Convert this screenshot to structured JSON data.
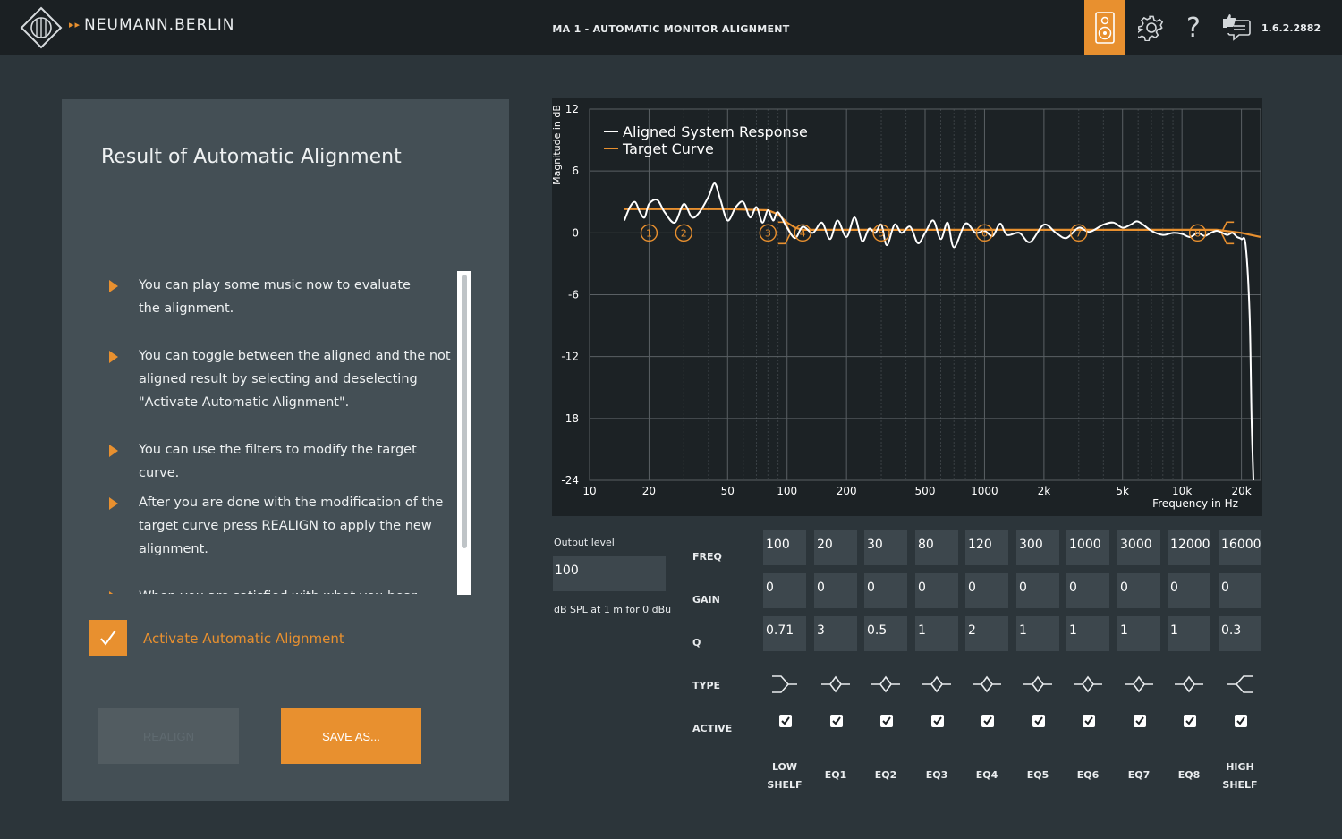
{
  "header": {
    "brand": "NEUMANN.BERLIN",
    "brand_arrows": "▸▸",
    "app_title": "MA 1 - AUTOMATIC MONITOR ALIGNMENT",
    "help_glyph": "?",
    "version": "1.6.2.2882"
  },
  "left_panel": {
    "title": "Result of Automatic Alignment",
    "tips": [
      {
        "line1": "You can play some music now to evaluate",
        "line2": "the alignment.",
        "line3": ""
      },
      {
        "line1": "You can toggle between the aligned and the not",
        "line2": "aligned result by selecting and deselecting",
        "line3": "\"Activate Automatic Alignment\"."
      },
      {
        "line1": "You can use the filters to modify the target curve.",
        "line2": "",
        "line3": ""
      },
      {
        "line1": "After you are done with the modification of the",
        "line2": "target curve press REALIGN to apply the new",
        "line3": "alignment."
      },
      {
        "line1": "When you are satisfied with what you hear please",
        "line2": "",
        "line3": ""
      }
    ],
    "activate_label": "Activate Automatic Alignment",
    "activate_checked": true,
    "realign_label": "REALIGN",
    "save_label": "SAVE AS..."
  },
  "output": {
    "label": "Output level",
    "value": "100",
    "unit": "dB SPL at 1 m for 0 dBu"
  },
  "eq": {
    "row_labels": {
      "freq": "FREQ",
      "gain": "GAIN",
      "q": "Q",
      "type": "TYPE",
      "active": "ACTIVE"
    },
    "bands": [
      {
        "name1": "LOW",
        "name2": "SHELF",
        "freq": "100",
        "gain": "0",
        "q": "0.71",
        "type": "low-shelf",
        "active": true
      },
      {
        "name1": "EQ1",
        "name2": "",
        "freq": "20",
        "gain": "0",
        "q": "3",
        "type": "peak",
        "active": true
      },
      {
        "name1": "EQ2",
        "name2": "",
        "freq": "30",
        "gain": "0",
        "q": "0.5",
        "type": "peak",
        "active": true
      },
      {
        "name1": "EQ3",
        "name2": "",
        "freq": "80",
        "gain": "0",
        "q": "1",
        "type": "peak",
        "active": true
      },
      {
        "name1": "EQ4",
        "name2": "",
        "freq": "120",
        "gain": "0",
        "q": "2",
        "type": "peak",
        "active": true
      },
      {
        "name1": "EQ5",
        "name2": "",
        "freq": "300",
        "gain": "0",
        "q": "1",
        "type": "peak",
        "active": true
      },
      {
        "name1": "EQ6",
        "name2": "",
        "freq": "1000",
        "gain": "0",
        "q": "1",
        "type": "peak",
        "active": true
      },
      {
        "name1": "EQ7",
        "name2": "",
        "freq": "3000",
        "gain": "0",
        "q": "1",
        "type": "peak",
        "active": true
      },
      {
        "name1": "EQ8",
        "name2": "",
        "freq": "12000",
        "gain": "0",
        "q": "1",
        "type": "peak",
        "active": true
      },
      {
        "name1": "HIGH",
        "name2": "SHELF",
        "freq": "16000",
        "gain": "0",
        "q": "0.3",
        "type": "high-shelf",
        "active": true
      }
    ]
  },
  "chart_data": {
    "type": "line",
    "xlabel": "Frequency in Hz",
    "ylabel": "Magnitude in dB",
    "x_scale": "log",
    "xlim": [
      10,
      25000
    ],
    "ylim": [
      -24,
      12
    ],
    "x_ticks": [
      10,
      20,
      50,
      100,
      200,
      500,
      1000,
      2000,
      5000,
      10000,
      20000
    ],
    "x_tick_labels": [
      "10",
      "20",
      "50",
      "100",
      "200",
      "500",
      "1000",
      "2k",
      "5k",
      "10k",
      "20k"
    ],
    "y_ticks": [
      12,
      6,
      0,
      -6,
      -12,
      -18,
      -24
    ],
    "grid": true,
    "legend_position": "top-left",
    "colors": {
      "aligned": "#ffffff",
      "target": "#e8902f"
    },
    "series": [
      {
        "name": "Aligned System Response",
        "x": [
          15,
          16,
          17,
          18,
          19,
          20,
          22,
          24,
          27,
          30,
          33,
          36,
          40,
          43,
          46,
          50,
          55,
          60,
          65,
          70,
          75,
          80,
          85,
          90,
          100,
          110,
          120,
          135,
          150,
          165,
          180,
          200,
          220,
          240,
          260,
          280,
          300,
          320,
          350,
          380,
          420,
          460,
          500,
          550,
          600,
          650,
          700,
          800,
          900,
          1000,
          1100,
          1200,
          1300,
          1500,
          1700,
          2000,
          2300,
          2600,
          3000,
          3400,
          4000,
          4500,
          5000,
          5500,
          6000,
          7000,
          8000,
          9000,
          10000,
          11000,
          12000,
          13000,
          14000,
          15000,
          16000,
          17000,
          18000,
          19000,
          20000,
          21000,
          22000,
          22500,
          23000
        ],
        "y": [
          1.2,
          2.5,
          3.0,
          2.0,
          1.5,
          2.8,
          3.2,
          2.0,
          1.0,
          2.8,
          1.5,
          2.0,
          3.5,
          4.8,
          3.2,
          1.2,
          2.5,
          3.0,
          1.5,
          2.5,
          1.0,
          2.2,
          1.2,
          2.0,
          0.5,
          -0.5,
          0.6,
          0.0,
          1.0,
          -0.6,
          1.2,
          -0.4,
          1.5,
          -0.8,
          0.4,
          0.0,
          0.8,
          -1.2,
          0.8,
          0.0,
          0.6,
          -1.0,
          0.0,
          1.2,
          -0.6,
          1.0,
          -1.4,
          0.9,
          0.0,
          0.2,
          -0.3,
          0.9,
          -0.2,
          0.0,
          -0.9,
          0.8,
          0.0,
          -0.5,
          0.5,
          0.1,
          0.8,
          1.0,
          0.5,
          0.8,
          1.1,
          0.2,
          -0.2,
          0.0,
          -0.1,
          -0.4,
          0.0,
          -0.3,
          0.0,
          0.2,
          0.0,
          -0.2,
          0.0,
          -0.4,
          -0.6,
          -1.2,
          -8.0,
          -18.0,
          -24.0
        ]
      },
      {
        "name": "Target Curve",
        "x": [
          15,
          20,
          30,
          50,
          80,
          90,
          100,
          110,
          120,
          150,
          200,
          500,
          1000,
          2000,
          5000,
          10000,
          15000,
          20000,
          25000
        ],
        "y": [
          2.3,
          2.3,
          2.3,
          2.3,
          2.2,
          1.8,
          1.0,
          0.5,
          0.3,
          0.3,
          0.3,
          0.3,
          0.3,
          0.3,
          0.3,
          0.3,
          0.3,
          0.0,
          -0.4
        ]
      }
    ],
    "markers": [
      {
        "label": "1",
        "freq": 20,
        "db": 0
      },
      {
        "label": "2",
        "freq": 30,
        "db": 0
      },
      {
        "label": "3",
        "freq": 80,
        "db": 0
      },
      {
        "label": "4",
        "freq": 120,
        "db": 0
      },
      {
        "label": "5",
        "freq": 300,
        "db": 0
      },
      {
        "label": "6",
        "freq": 1000,
        "db": 0
      },
      {
        "label": "7",
        "freq": 3000,
        "db": 0
      },
      {
        "label": "8",
        "freq": 12000,
        "db": 0
      }
    ]
  }
}
